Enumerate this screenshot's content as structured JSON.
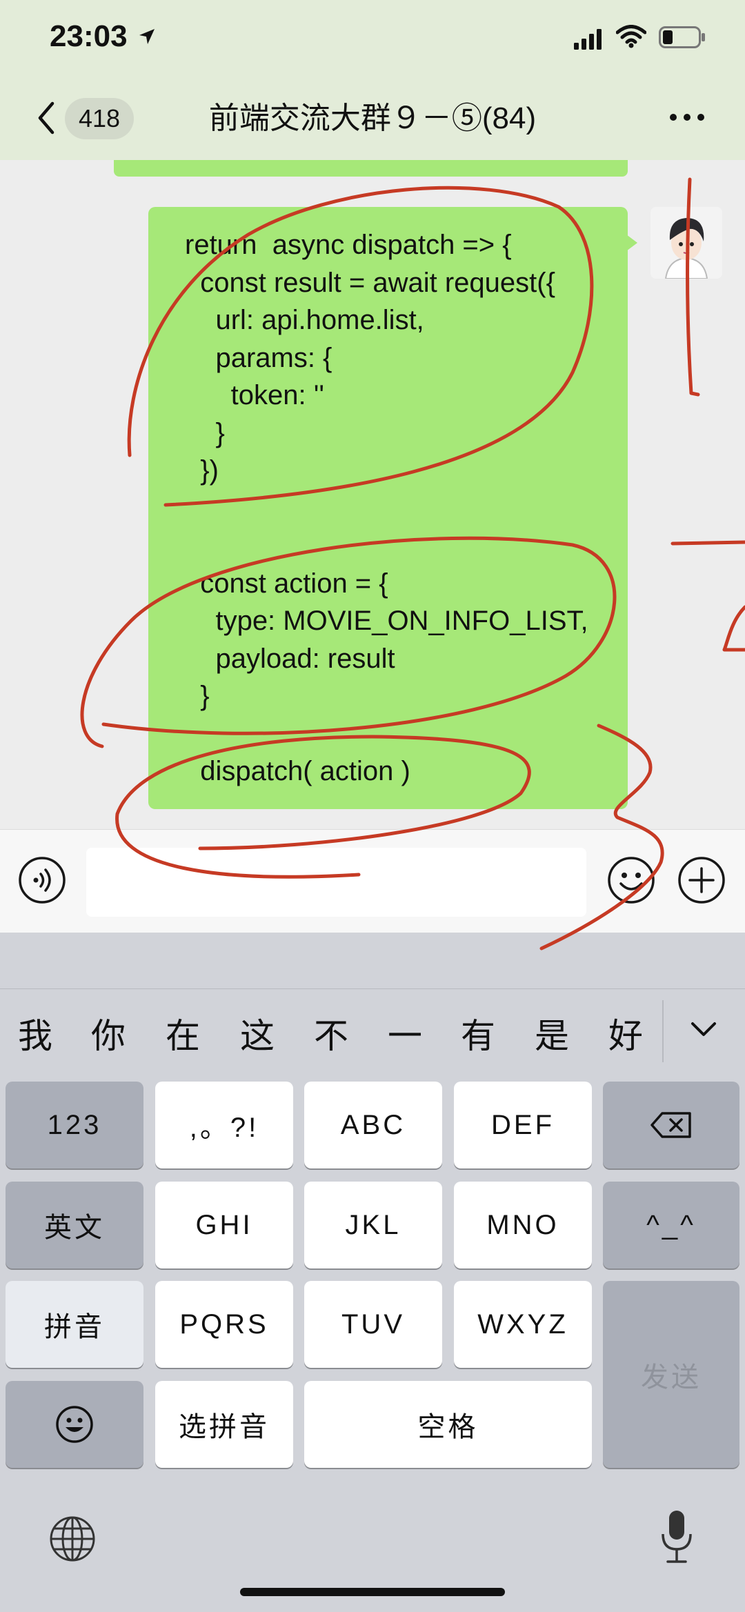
{
  "status_bar": {
    "time": "23:03"
  },
  "nav": {
    "unread_count": "418",
    "title": "前端交流大群９－⑤(84)"
  },
  "message": {
    "text": "return  async dispatch => {\n  const result = await request({\n    url: api.home.list,\n    params: {\n      token: ''\n    }\n  })\n\n\n  const action = {\n    type: MOVIE_ON_INFO_LIST,\n    payload: result\n  }\n\n  dispatch( action )"
  },
  "keyboard": {
    "candidates": [
      "我",
      "你",
      "在",
      "这",
      "不",
      "一",
      "有",
      "是",
      "好"
    ],
    "keys": {
      "num": "123",
      "punct": ",。?!",
      "abc": "ABC",
      "def": "DEF",
      "english": "英文",
      "ghi": "GHI",
      "jkl": "JKL",
      "mno": "MNO",
      "face": "^_^",
      "pinyin": "拼音",
      "pqrs": "PQRS",
      "tuv": "TUV",
      "wxyz": "WXYZ",
      "send": "发送",
      "select_pinyin": "选拼音",
      "space": "空格"
    }
  },
  "icons": {
    "back": "chevron-left-icon",
    "more": "more-dots-icon",
    "voice": "voice-icon",
    "emoji": "emoji-icon",
    "plus": "plus-icon",
    "delete": "backspace-icon",
    "globe": "globe-icon",
    "mic": "microphone-icon"
  },
  "colors": {
    "bubble": "#a6e878",
    "annotation": "#c63a24",
    "navbar": "#e3ecd9"
  }
}
